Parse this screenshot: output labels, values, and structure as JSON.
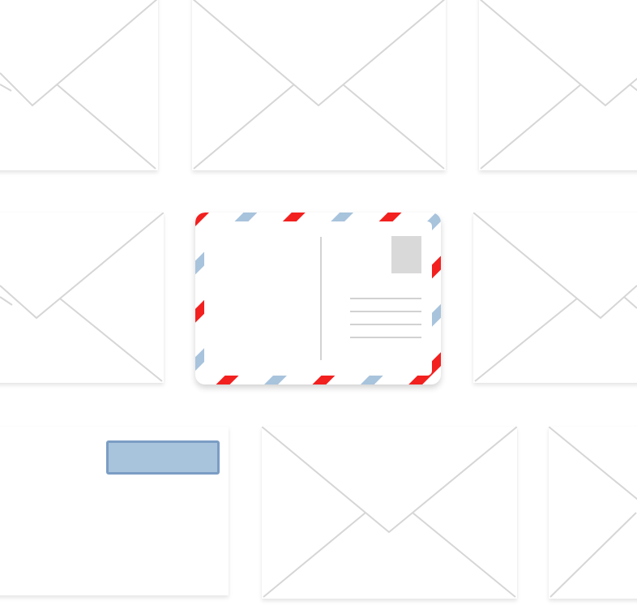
{
  "colors": {
    "background": "#ffffff",
    "envelope": "#ffffff",
    "envelope_lines": "#d6d6d6",
    "airmail_red": "#f2201f",
    "airmail_blue": "#a8c3dc",
    "stamp": "#d9d9d9",
    "address_window_fill": "#a8c3dc",
    "address_window_border": "#7b9dc4"
  },
  "envelopes": [
    {
      "name": "envelope-top-left",
      "icon": "envelope-icon"
    },
    {
      "name": "envelope-top-center",
      "icon": "envelope-icon"
    },
    {
      "name": "envelope-top-right",
      "icon": "envelope-icon"
    },
    {
      "name": "envelope-middle-left",
      "icon": "envelope-icon"
    },
    {
      "name": "envelope-middle-right",
      "icon": "envelope-icon"
    },
    {
      "name": "envelope-bottom-left-window",
      "icon": "window-envelope-icon"
    },
    {
      "name": "envelope-bottom-center",
      "icon": "envelope-icon"
    },
    {
      "name": "envelope-bottom-right",
      "icon": "envelope-icon"
    }
  ],
  "postcard": {
    "icon": "airmail-postcard-icon",
    "address_lines": 4
  }
}
